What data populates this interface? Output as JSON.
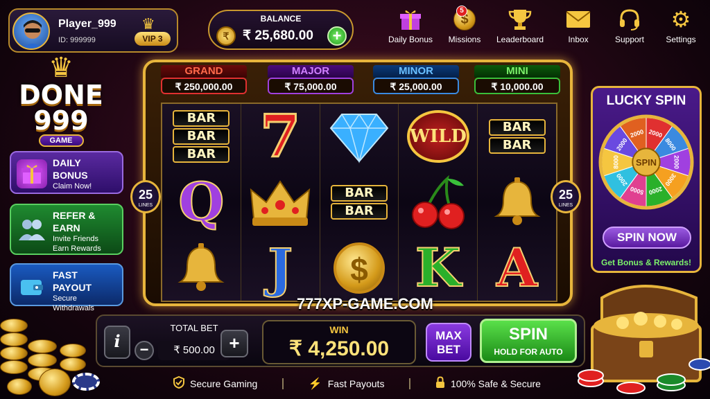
{
  "player": {
    "name": "Player_999",
    "id": "ID: 999999",
    "vip": "VIP 3"
  },
  "balance": {
    "label": "BALANCE",
    "value": "₹ 25,680.00",
    "coin_icon": "rupee-coin-icon",
    "add_icon": "plus-icon"
  },
  "top_menu": [
    {
      "label": "Daily Bonus",
      "icon": "gift-icon"
    },
    {
      "label": "Missions",
      "icon": "coin-dollar-icon",
      "badge": "5"
    },
    {
      "label": "Leaderboard",
      "icon": "trophy-icon"
    },
    {
      "label": "Inbox",
      "icon": "envelope-icon"
    },
    {
      "label": "Support",
      "icon": "headset-icon"
    },
    {
      "label": "Settings",
      "icon": "gear-icon"
    }
  ],
  "logo": {
    "line1": "DONE",
    "line2": "999",
    "line3": "GAME"
  },
  "promos": [
    {
      "title": "DAILY BONUS",
      "subtitle": "Claim Now!",
      "icon": "gift-icon"
    },
    {
      "title": "REFER & EARN",
      "subtitle": "Invite Friends",
      "subtitle2": "Earn Rewards",
      "icon": "users-icon"
    },
    {
      "title": "FAST PAYOUT",
      "subtitle": "Secure Withdrawals",
      "icon": "wallet-icon"
    }
  ],
  "jackpots": [
    {
      "name": "GRAND",
      "value": "₹ 250,000.00",
      "color": "#e03030"
    },
    {
      "name": "MAJOR",
      "value": "₹ 75,000.00",
      "color": "#a040e0"
    },
    {
      "name": "MINOR",
      "value": "₹ 25,000.00",
      "color": "#3a8ae0"
    },
    {
      "name": "MINI",
      "value": "₹ 10,000.00",
      "color": "#3ac03a"
    }
  ],
  "lines": {
    "count": "25",
    "label": "LINES"
  },
  "reels": {
    "bar_label": "BAR",
    "wild_label": "WILD",
    "q": "Q",
    "j": "J",
    "k": "K",
    "a": "A",
    "seven": "7",
    "dollar": "$"
  },
  "lucky_spin": {
    "title": "LUCKY SPIN",
    "center": "SPIN",
    "button": "SPIN NOW",
    "subtitle": "Get Bonus & Rewards!",
    "segments": [
      "2000",
      "8000",
      "2000",
      "3000",
      "2000",
      "5000",
      "2000",
      "8000",
      "2000",
      "2000"
    ]
  },
  "watermark": "777XP-GAME.COM",
  "controls": {
    "info": "i",
    "total_bet_label": "TOTAL BET",
    "total_bet_value": "₹ 500.00",
    "minus": "−",
    "plus": "+",
    "win_label": "WIN",
    "win_value": "₹ 4,250.00",
    "max_bet": [
      "MAX",
      "BET"
    ],
    "spin": "SPIN",
    "spin_sub": "HOLD FOR AUTO"
  },
  "footer": [
    {
      "label": "Secure Gaming",
      "icon": "shield-check-icon"
    },
    {
      "label": "Fast Payouts",
      "icon": "lightning-icon"
    },
    {
      "label": "100% Safe & Secure",
      "icon": "lock-icon"
    }
  ],
  "colors": {
    "gold": "#e7b53c",
    "green": "#3ac03a",
    "purple": "#5a1aa0",
    "red": "#e02020"
  }
}
